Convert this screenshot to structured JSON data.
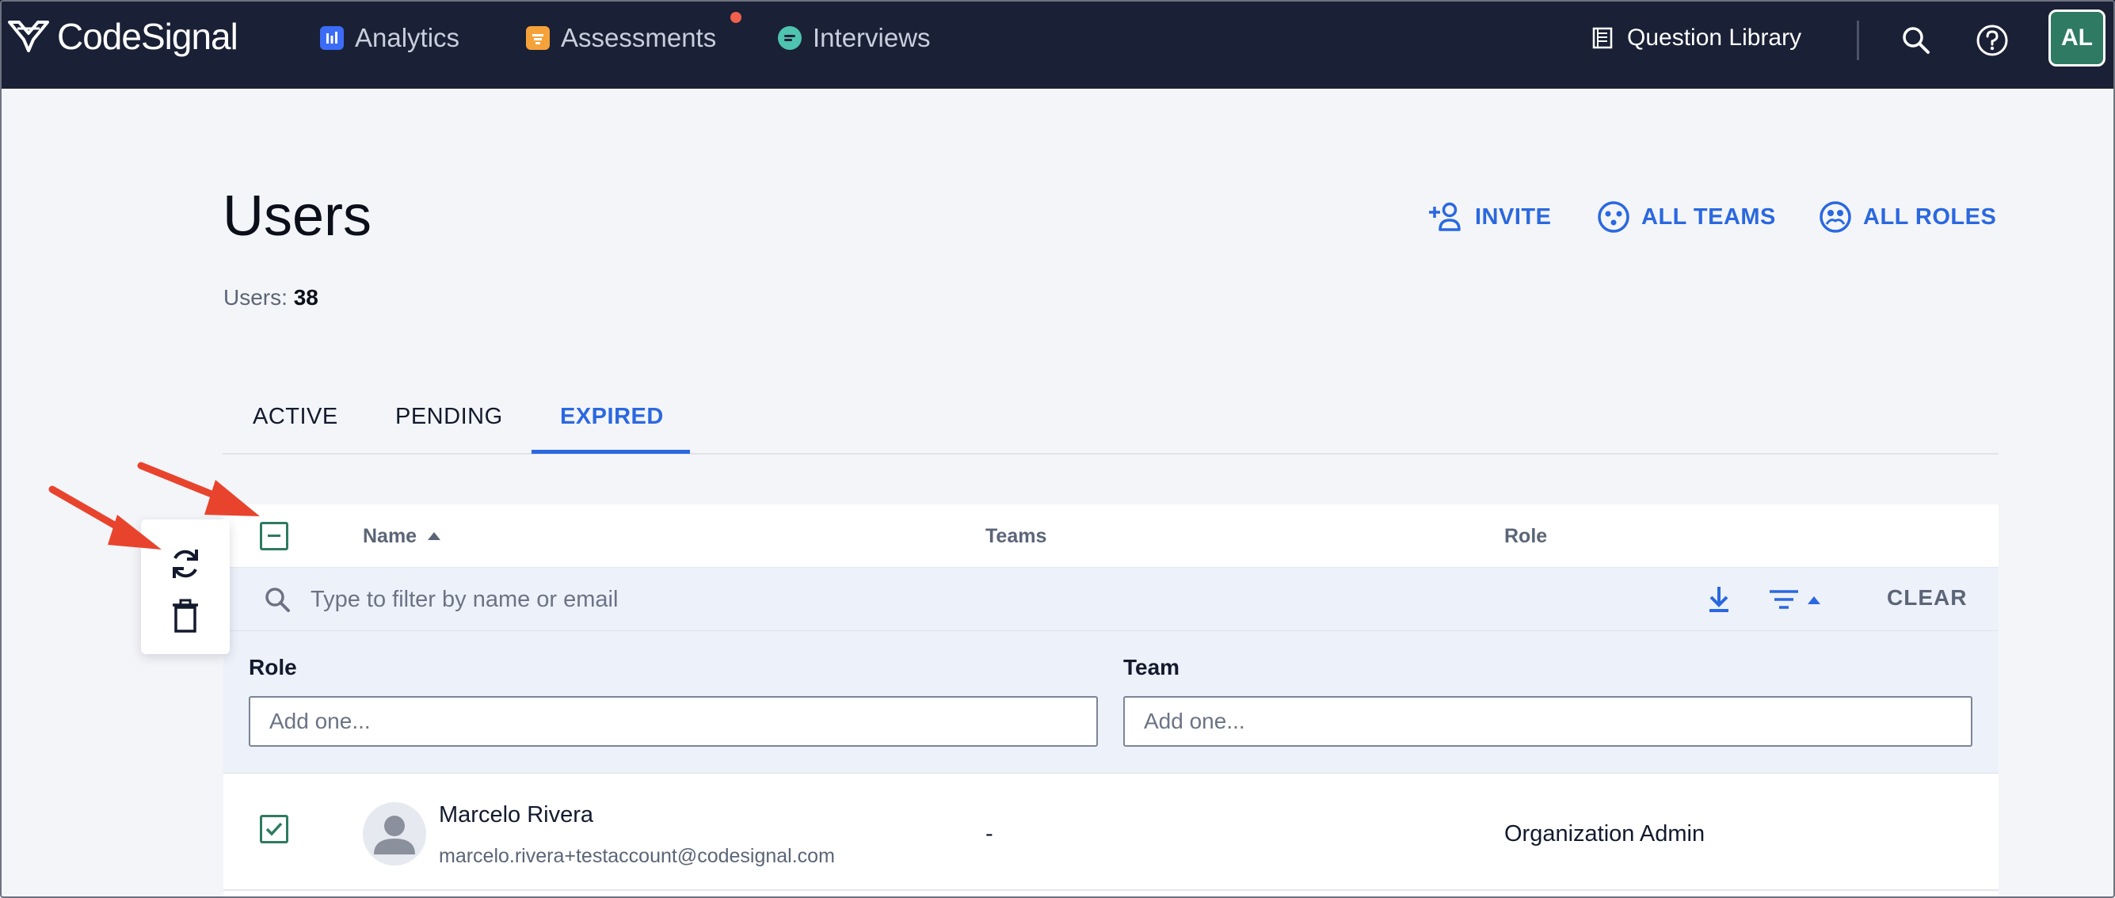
{
  "app": {
    "brand": "CodeSignal"
  },
  "nav": {
    "items": [
      {
        "label": "Analytics",
        "icon": "analytics-icon",
        "color": "#3b6cf6"
      },
      {
        "label": "Assessments",
        "icon": "assessments-icon",
        "color": "#f5a23a",
        "has_notification": true
      },
      {
        "label": "Interviews",
        "icon": "interviews-icon",
        "color": "#4ec3b0"
      }
    ],
    "question_library": "Question Library",
    "avatar_initials": "AL"
  },
  "page": {
    "title": "Users",
    "count_label": "Users:",
    "count_value": "38",
    "actions": {
      "invite": "INVITE",
      "all_teams": "ALL TEAMS",
      "all_roles": "ALL ROLES"
    }
  },
  "tabs": [
    {
      "label": "ACTIVE",
      "active": false
    },
    {
      "label": "PENDING",
      "active": false
    },
    {
      "label": "EXPIRED",
      "active": true
    }
  ],
  "table": {
    "columns": {
      "name": "Name",
      "teams": "Teams",
      "role": "Role"
    },
    "filter": {
      "placeholder": "Type to filter by name or email",
      "clear_label": "CLEAR"
    },
    "filters_panel": {
      "role_label": "Role",
      "role_placeholder": "Add one...",
      "team_label": "Team",
      "team_placeholder": "Add one..."
    },
    "rows": [
      {
        "name": "Marcelo Rivera",
        "email": "marcelo.rivera+testaccount@codesignal.com",
        "teams": "-",
        "role": "Organization Admin",
        "checked": true
      }
    ]
  },
  "bulk_actions": [
    "refresh-icon",
    "trash-icon"
  ],
  "colors": {
    "nav_bg": "#1a2035",
    "accent": "#2a68e0",
    "checkbox": "#2e7a62",
    "annotation_arrow": "#e8442d"
  }
}
